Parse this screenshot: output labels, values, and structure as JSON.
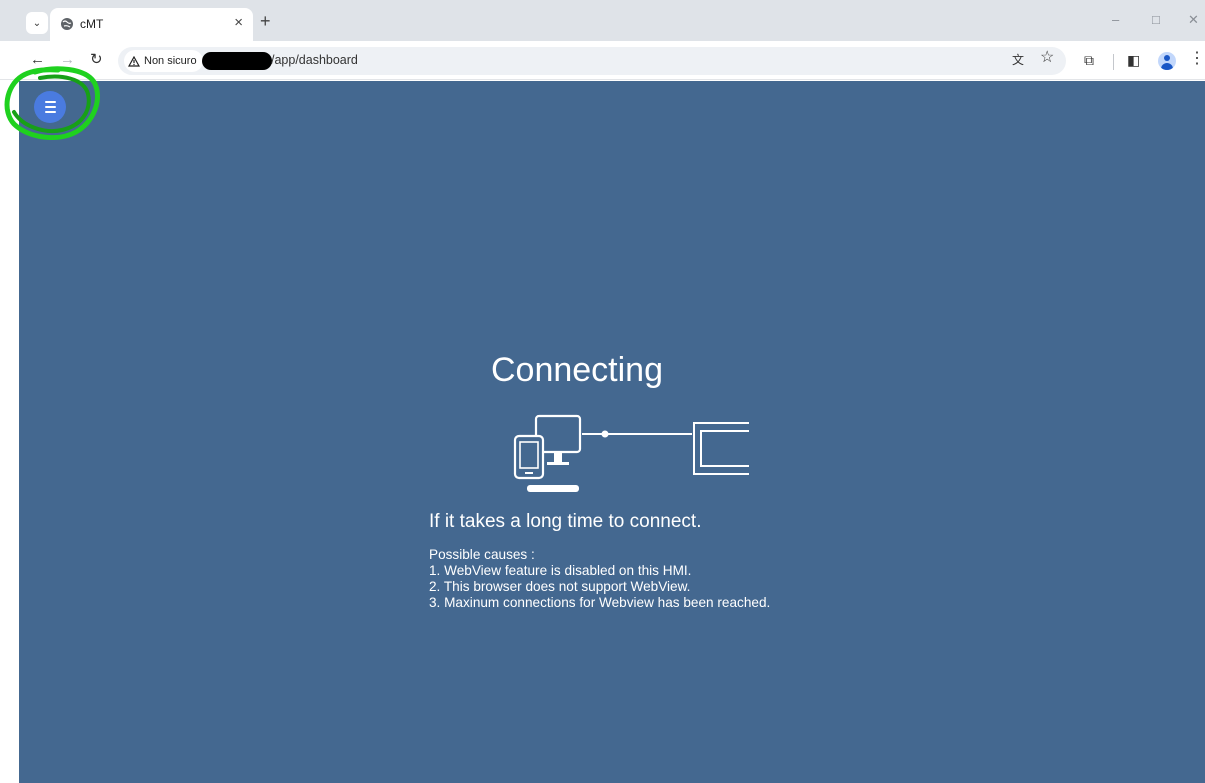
{
  "browser": {
    "tab": {
      "title": "cMT",
      "close_glyph": "×"
    },
    "new_tab_glyph": "+",
    "tab_search_glyph": "⌄",
    "window_controls": {
      "minimize": "–",
      "maximize": "□",
      "close": "✕"
    },
    "nav": {
      "back": "←",
      "forward": "→",
      "reload": "↻"
    },
    "omnibox": {
      "security_label": "Non sicuro",
      "url_suffix": "/app/dashboard"
    },
    "toolbar_icons": {
      "translate": "文",
      "bookmark": "☆",
      "extensions": "⧉",
      "side_panel": "◧",
      "more": "⋮"
    }
  },
  "page": {
    "title": "Connecting",
    "hint": "If it takes a long time to connect.",
    "causes_heading": "Possible causes :",
    "causes": [
      "1. WebView feature is disabled on this HMI.",
      "2. This browser does not support WebView.",
      "3. Maxinum connections for Webview has been reached."
    ]
  },
  "colors": {
    "page_background": "#446890",
    "menu_button": "#4a7be0",
    "annotation": "#1fd11f"
  },
  "icons": {
    "menu": "hamburger-menu-icon",
    "illustration": "devices-to-hmi-connection-icon"
  }
}
